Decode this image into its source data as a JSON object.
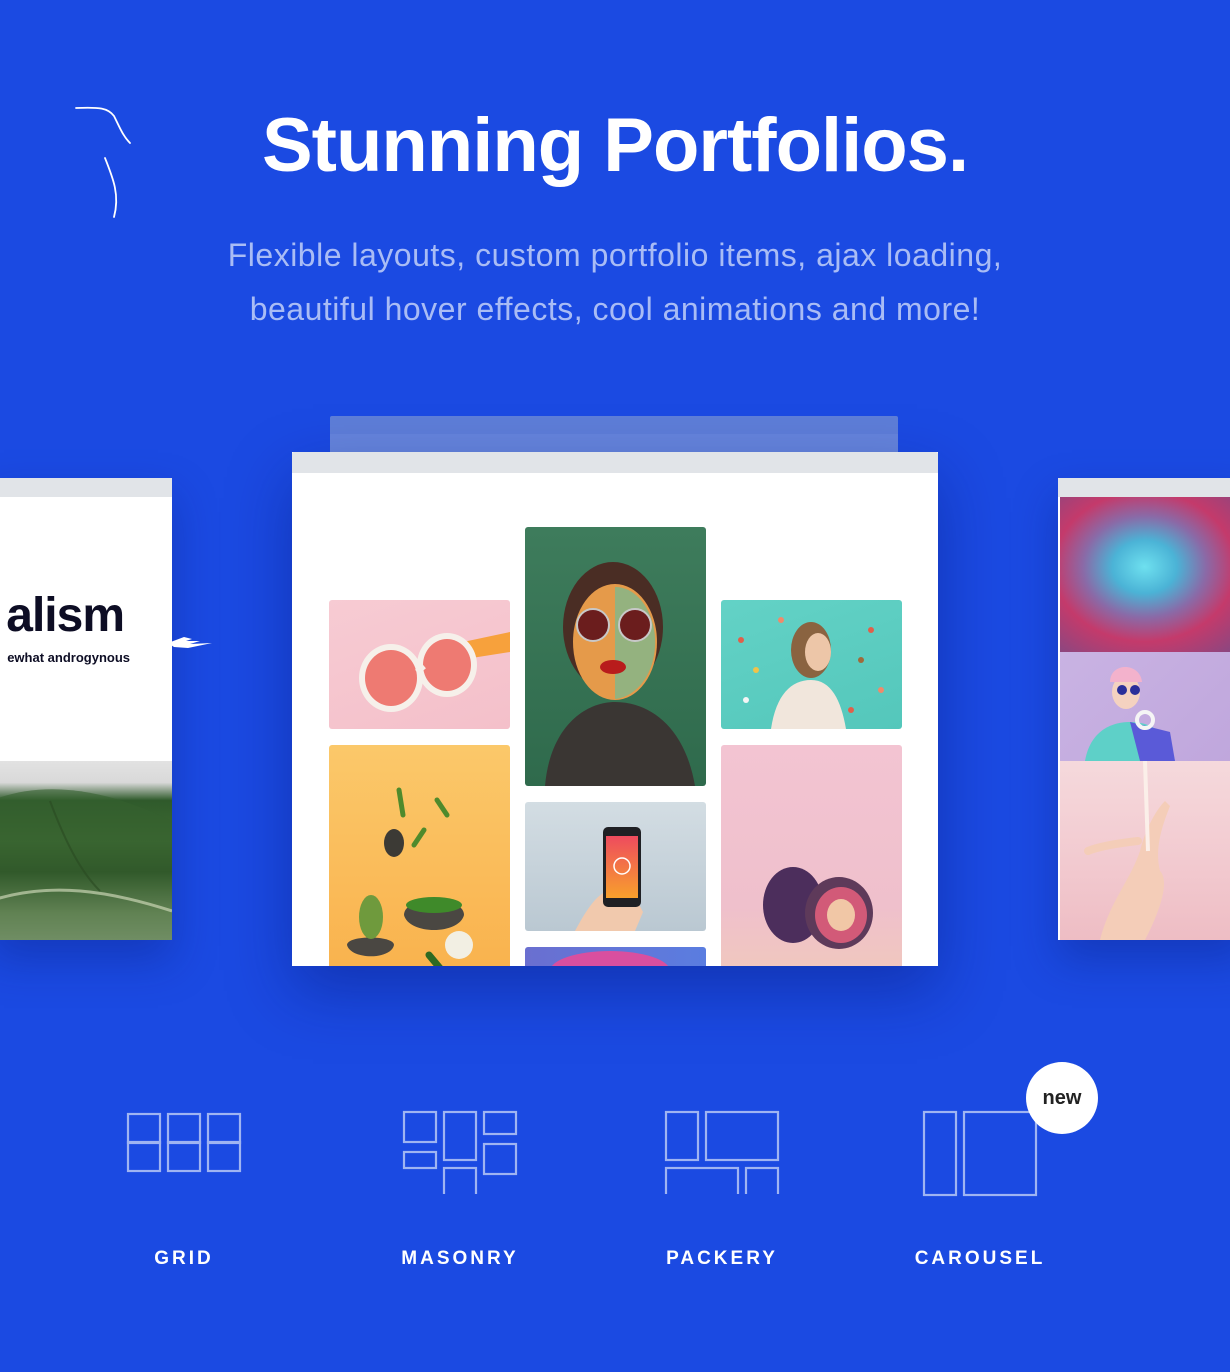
{
  "hero": {
    "title": "Stunning Portfolios.",
    "subtitle_line1": "Flexible layouts, custom portfolio items, ajax loading,",
    "subtitle_line2": "beautiful hover effects, cool animations and more!"
  },
  "colors": {
    "background": "#1b4ae2",
    "title": "#ffffff",
    "subtitle": "#a9bcf5",
    "icon_stroke": "#9fb4f2",
    "badge_bg": "#ffffff",
    "badge_text": "#222222"
  },
  "preview_left": {
    "heading_fragment": "alism",
    "subheading_fragment": "ewhat androgynous",
    "image": "green-leaf-photo"
  },
  "preview_center": {
    "tiles": [
      {
        "name": "watermelon-sunglasses-photo"
      },
      {
        "name": "woman-round-sunglasses-portrait-photo"
      },
      {
        "name": "woman-confetti-teal-photo"
      },
      {
        "name": "peppers-mortar-orange-photo"
      },
      {
        "name": "hand-holding-phone-photo"
      },
      {
        "name": "figs-pink-photo"
      },
      {
        "name": "pink-hair-photo"
      }
    ]
  },
  "preview_right": {
    "images": [
      {
        "name": "glitch-portrait-photo"
      },
      {
        "name": "woman-pink-beanie-headphones-photo"
      },
      {
        "name": "hand-pink-background-photo"
      }
    ]
  },
  "layouts": [
    {
      "label": "GRID",
      "icon": "grid-layout-icon"
    },
    {
      "label": "MASONRY",
      "icon": "masonry-layout-icon"
    },
    {
      "label": "PACKERY",
      "icon": "packery-layout-icon"
    },
    {
      "label": "CAROUSEL",
      "icon": "carousel-layout-icon",
      "badge": "new"
    }
  ]
}
